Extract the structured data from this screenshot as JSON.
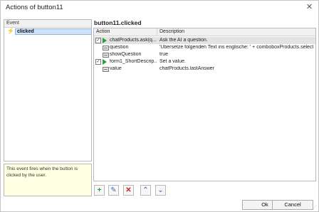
{
  "window": {
    "title": "Actions of button11",
    "close_glyph": "✕"
  },
  "events_panel": {
    "header": "Event",
    "items": [
      {
        "label": "clicked",
        "icon": "lightning-icon",
        "selected": true
      }
    ],
    "description": "This event fires when the button is clicked by the user."
  },
  "actions_panel": {
    "title": "button11.clicked",
    "columns": {
      "action": "Action",
      "description": "Description"
    },
    "rows": [
      {
        "type": "action",
        "checked": true,
        "action": "chatProducts.ask(q...",
        "description": "Ask the AI a question.",
        "selected": true
      },
      {
        "type": "property",
        "checked": false,
        "action": "question",
        "description": "'Übersetze folgenden Text ins englische: ' + comboboxProducts.selectedR..."
      },
      {
        "type": "property",
        "checked": false,
        "action": "showQuestion",
        "description": "true"
      },
      {
        "type": "action",
        "checked": true,
        "action": "form1_ShortDescrip...",
        "description": "Set a value."
      },
      {
        "type": "property",
        "checked": false,
        "action": "value",
        "description": "chatProducts.lastAnswer"
      }
    ]
  },
  "toolbar": {
    "add": "+",
    "edit": "✎",
    "delete": "✕",
    "up": "⌃",
    "down": "⌄"
  },
  "buttons": {
    "ok": "Ok",
    "cancel": "Cancel"
  },
  "check_glyph": "✓",
  "colors": {
    "play": "#2e9d3a",
    "selection": "#cfe3f8",
    "hint_background": "#ffffe1"
  }
}
